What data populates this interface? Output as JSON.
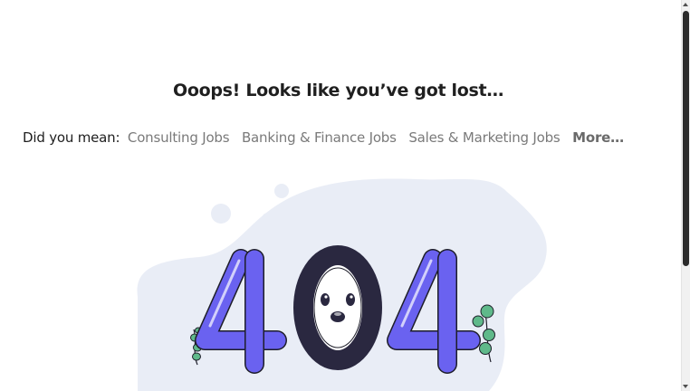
{
  "error": {
    "title": "Ooops! Looks like you’ve got lost…",
    "suggest_label": "Did you mean:",
    "suggestions": [
      "Consulting Jobs",
      "Banking & Finance Jobs",
      "Sales & Marketing Jobs"
    ],
    "more_label": "More…"
  },
  "illustration": {
    "digits": [
      "4",
      "0",
      "4"
    ],
    "colors": {
      "blob": "#e9edf6",
      "four": "#6a62f0",
      "zero": "#2a2840",
      "leaf": "#5fb98a",
      "outline": "#1e1e2a"
    }
  }
}
